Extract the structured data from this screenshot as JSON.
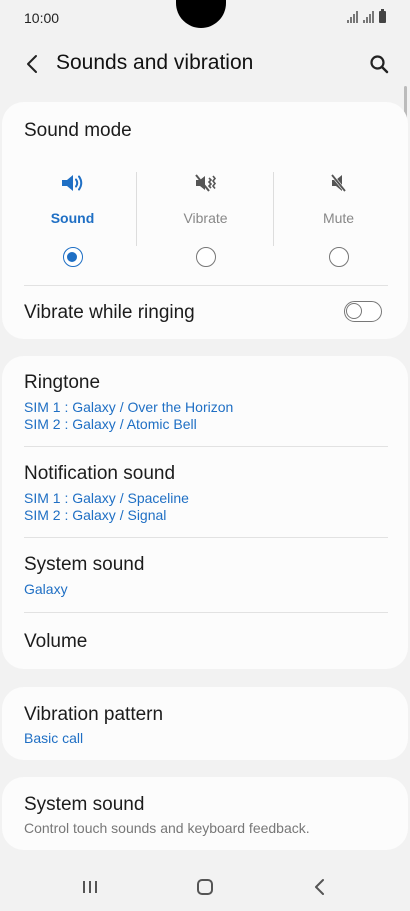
{
  "status_bar": {
    "time": "10:00"
  },
  "app_bar": {
    "title": "Sounds and vibration"
  },
  "sound_mode": {
    "title": "Sound mode",
    "options": [
      {
        "label": "Sound",
        "selected": true
      },
      {
        "label": "Vibrate",
        "selected": false
      },
      {
        "label": "Mute",
        "selected": false
      }
    ],
    "vibrate_while_ringing": {
      "label": "Vibrate while ringing",
      "enabled": false
    }
  },
  "ringtone": {
    "title": "Ringtone",
    "sim1": "SIM 1 : Galaxy / Over the Horizon",
    "sim2": "SIM 2 : Galaxy / Atomic Bell"
  },
  "notification_sound": {
    "title": "Notification sound",
    "sim1": "SIM 1 : Galaxy / Spaceline",
    "sim2": "SIM 2 : Galaxy / Signal"
  },
  "system_sound": {
    "title": "System sound",
    "value": "Galaxy"
  },
  "volume": {
    "title": "Volume"
  },
  "vibration_pattern": {
    "title": "Vibration pattern",
    "value": "Basic call"
  },
  "system_sound_control": {
    "title": "System sound",
    "description": "Control touch sounds and keyboard feedback."
  },
  "colors": {
    "accent": "#1f6fc4",
    "background": "#f2f2f2",
    "card": "#fcfcfc"
  },
  "icons": {
    "back": "back-arrow-icon",
    "search": "search-icon",
    "sound": "speaker-icon",
    "vibrate": "vibrate-icon",
    "mute": "mute-icon",
    "recents": "recents-icon",
    "home": "home-icon",
    "nav_back": "nav-back-icon"
  }
}
